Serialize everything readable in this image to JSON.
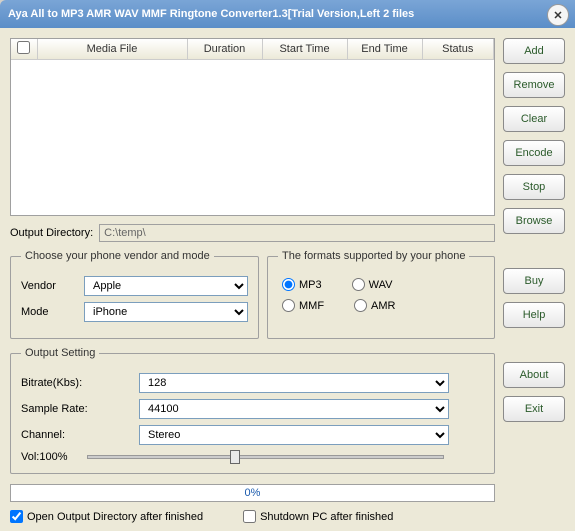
{
  "title": "Aya All to MP3 AMR WAV MMF Ringtone Converter1.3[Trial Version,Left 2 files",
  "columns": [
    "Media File",
    "Duration",
    "Start Time",
    "End Time",
    "Status"
  ],
  "buttons": {
    "add": "Add",
    "remove": "Remove",
    "clear": "Clear",
    "encode": "Encode",
    "stop": "Stop",
    "browse": "Browse",
    "buy": "Buy",
    "help": "Help",
    "about": "About",
    "exit": "Exit"
  },
  "output_dir": {
    "label": "Output Directory:",
    "value": "C:\\temp\\"
  },
  "vendor_group": {
    "legend": "Choose your phone vendor and mode",
    "vendor_label": "Vendor",
    "vendor_value": "Apple",
    "mode_label": "Mode",
    "mode_value": "iPhone"
  },
  "formats_group": {
    "legend": "The formats supported by your phone",
    "options": [
      "MP3",
      "WAV",
      "MMF",
      "AMR"
    ],
    "selected": "MP3"
  },
  "output_setting": {
    "legend": "Output Setting",
    "bitrate_label": "Bitrate(Kbs):",
    "bitrate_value": "128",
    "sample_label": "Sample Rate:",
    "sample_value": "44100",
    "channel_label": "Channel:",
    "channel_value": "Stereo",
    "vol_label": "Vol:100%"
  },
  "progress": "0%",
  "checks": {
    "open_dir": "Open Output Directory after finished",
    "shutdown": "Shutdown PC after finished"
  }
}
